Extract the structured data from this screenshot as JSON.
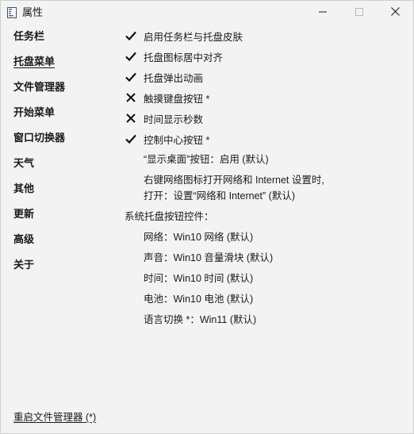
{
  "window": {
    "title": "属性",
    "icons": {
      "app": "app-icon",
      "minimize": "minimize-icon",
      "maximize": "maximize-icon",
      "close": "close-icon"
    }
  },
  "sidebar": {
    "items": [
      {
        "label": "任务栏",
        "active": false
      },
      {
        "label": "托盘菜单",
        "active": true
      },
      {
        "label": "文件管理器",
        "active": false
      },
      {
        "label": "开始菜单",
        "active": false
      },
      {
        "label": "窗口切换器",
        "active": false
      },
      {
        "label": "天气",
        "active": false
      },
      {
        "label": "其他",
        "active": false
      },
      {
        "label": "更新",
        "active": false
      },
      {
        "label": "高级",
        "active": false
      },
      {
        "label": "关于",
        "active": false
      }
    ]
  },
  "options": [
    {
      "label": "启用任务栏与托盘皮肤",
      "state": "check"
    },
    {
      "label": "托盘图标居中对齐",
      "state": "check"
    },
    {
      "label": "托盘弹出动画",
      "state": "check"
    },
    {
      "label": "触摸键盘按钮 *",
      "state": "cross"
    },
    {
      "label": "时间显示秒数",
      "state": "cross"
    },
    {
      "label": "控制中心按钮 *",
      "state": "check"
    }
  ],
  "show_desktop": "“显示桌面”按钮：启用 (默认)",
  "network_right_click": {
    "line1": "右键网络图标打开网络和 Internet 设置时,",
    "line2": "打开：设置“网络和 Internet” (默认)"
  },
  "tray_controls": {
    "heading": "系统托盘按钮控件：",
    "items": [
      "网络：Win10 网络 (默认)",
      "声音：Win10 音量滑块 (默认)",
      "时间：Win10 时间 (默认)",
      "电池：Win10 电池 (默认)",
      "语言切换 *：Win11 (默认)"
    ]
  },
  "footer": {
    "restart_link": "重启文件管理器 (*)"
  },
  "colors": {
    "background": "#f3f3f3",
    "text": "#1a1a1a",
    "accent_icon": "#2f6fd0"
  }
}
